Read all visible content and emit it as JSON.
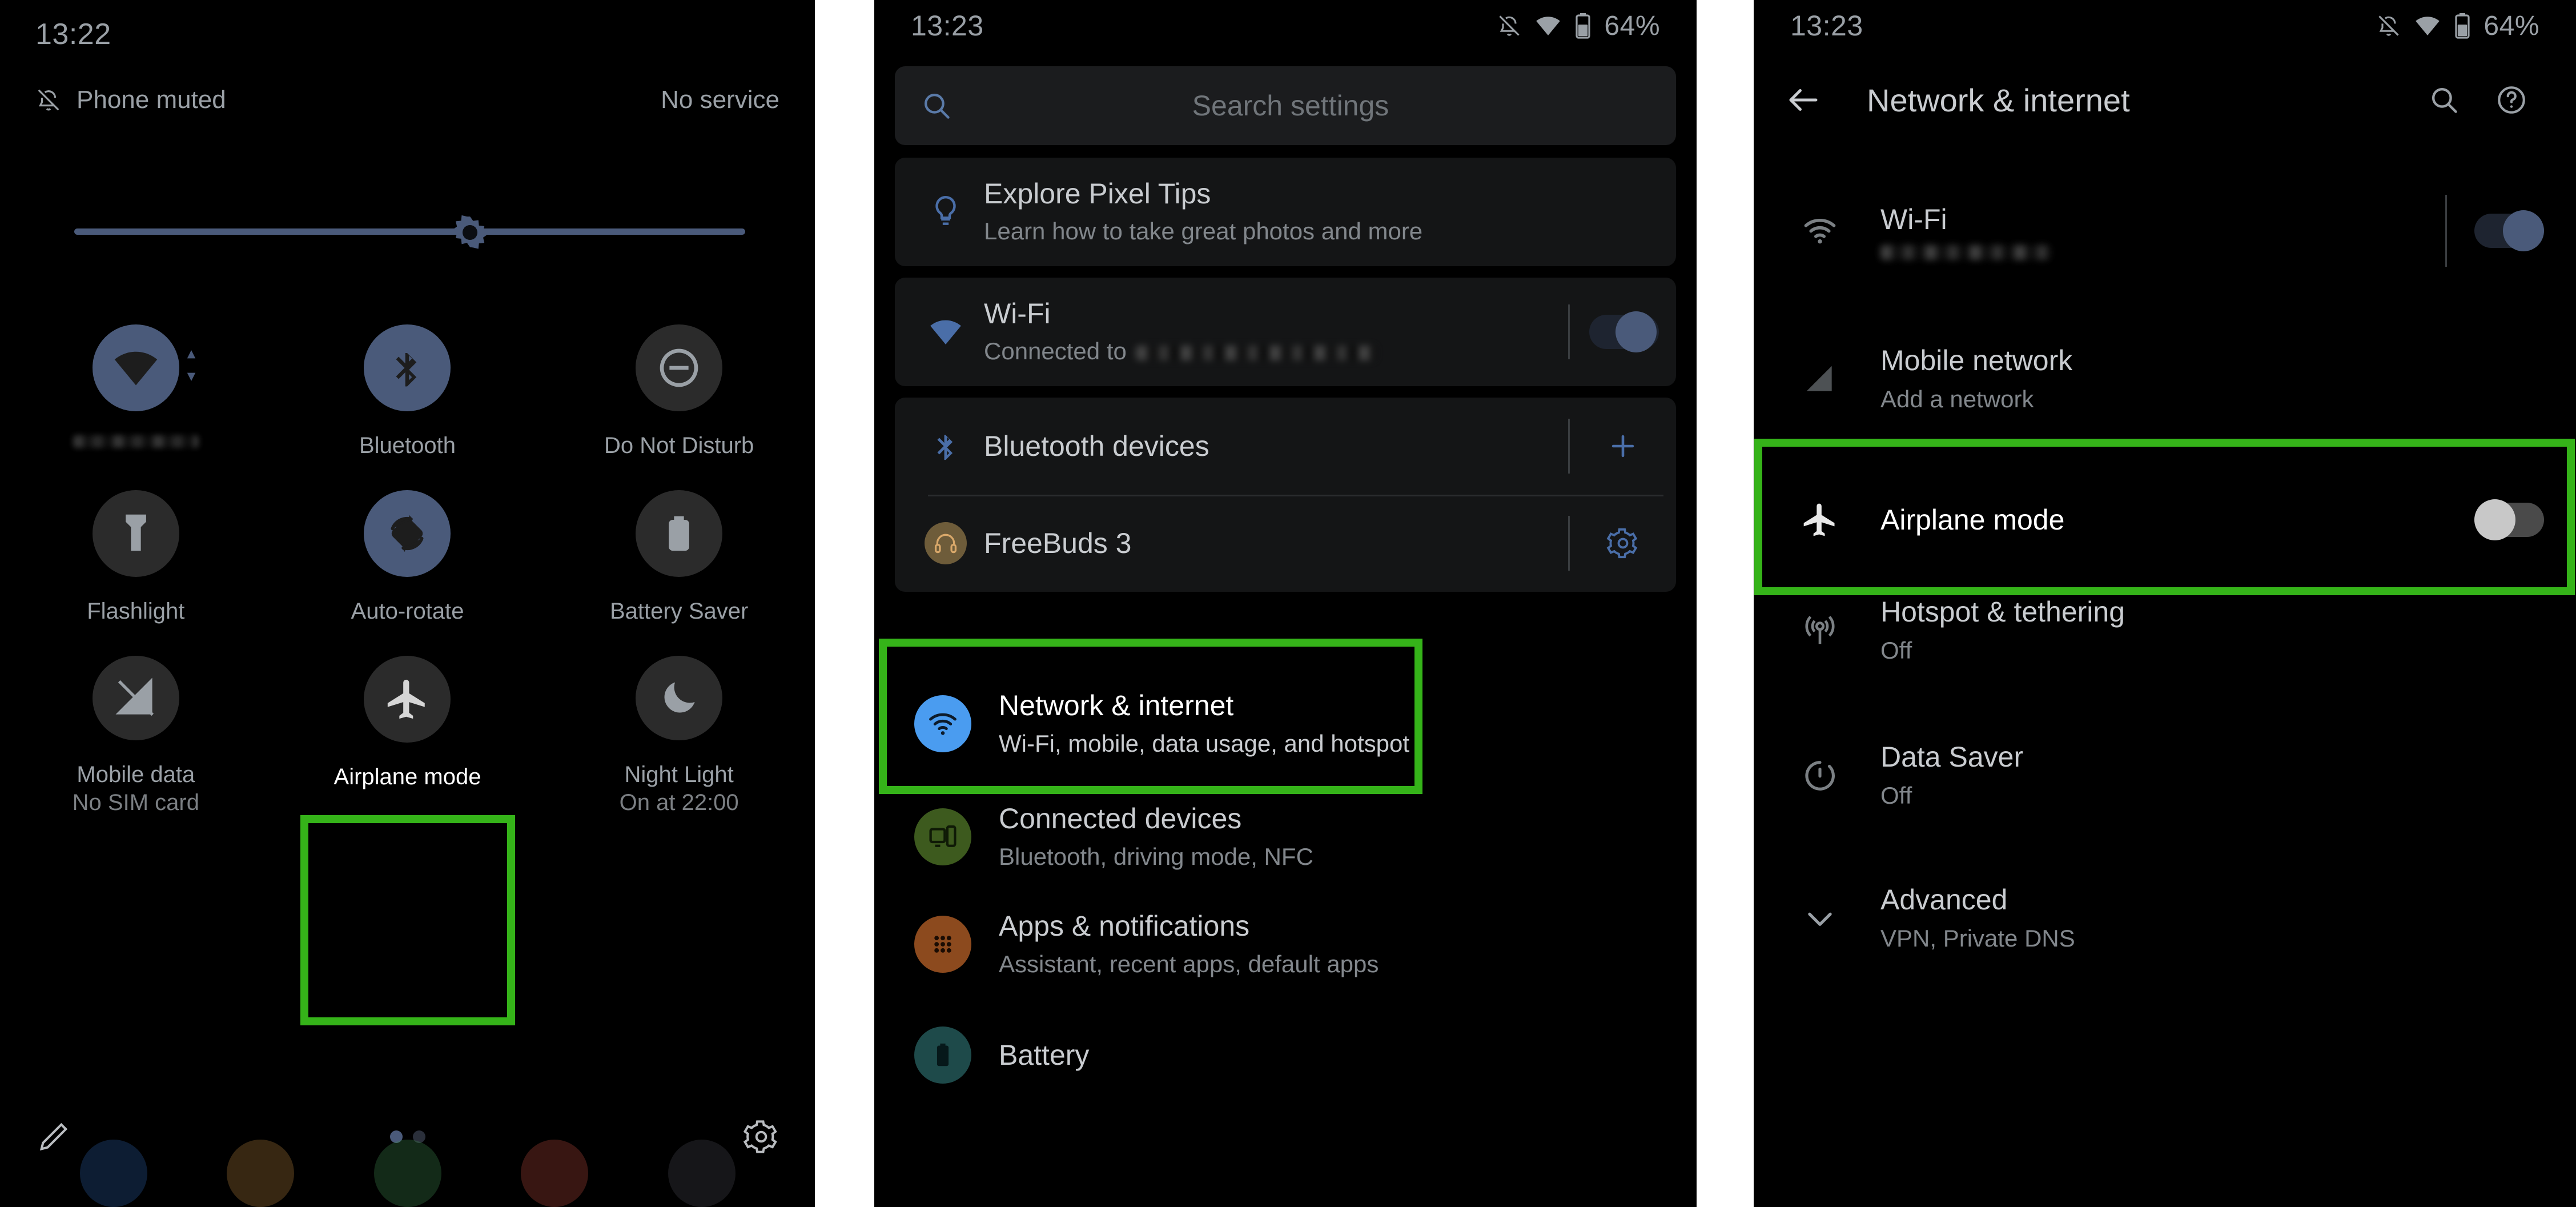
{
  "colors": {
    "highlight_green": "#35b319",
    "tile_active": "#4a5a7a",
    "tile_inactive": "#2b2b2b",
    "network_icon_blue": "#4a9cf0",
    "connected_icon_green": "#3d5a1e",
    "apps_icon_orange": "#8c4a1e",
    "battery_icon_teal": "#1e4a4a",
    "freebuds_icon_tan": "#8c7a52",
    "text_primary": "#c9ccd0",
    "text_secondary": "#82878c"
  },
  "quick_settings": {
    "clock": "13:22",
    "ringer_status": "Phone muted",
    "ringer_icon": "bell-off-icon",
    "service_status": "No service",
    "brightness_percent": 59,
    "tiles": [
      {
        "label": "",
        "sub": "",
        "icon": "wifi-icon",
        "state": "on",
        "redacted_label": true,
        "has_caret": true
      },
      {
        "label": "Bluetooth",
        "sub": "",
        "icon": "bluetooth-icon",
        "state": "on",
        "redacted_label": false,
        "has_caret": false
      },
      {
        "label": "Do Not Disturb",
        "sub": "",
        "icon": "do-not-disturb-icon",
        "state": "off",
        "redacted_label": false,
        "has_caret": false
      },
      {
        "label": "Flashlight",
        "sub": "",
        "icon": "flashlight-icon",
        "state": "off",
        "redacted_label": false,
        "has_caret": false
      },
      {
        "label": "Auto-rotate",
        "sub": "",
        "icon": "auto-rotate-icon",
        "state": "on",
        "redacted_label": false,
        "has_caret": false
      },
      {
        "label": "Battery Saver",
        "sub": "",
        "icon": "battery-saver-icon",
        "state": "off",
        "redacted_label": false,
        "has_caret": false
      },
      {
        "label": "Mobile data",
        "sub": "No SIM card",
        "icon": "mobile-data-off-icon",
        "state": "off",
        "redacted_label": false,
        "has_caret": false
      },
      {
        "label": "Airplane mode",
        "sub": "",
        "icon": "airplane-icon",
        "state": "off",
        "redacted_label": false,
        "has_caret": false,
        "highlighted": true
      },
      {
        "label": "Night Light",
        "sub": "On at 22:00",
        "icon": "night-light-icon",
        "state": "off",
        "redacted_label": false,
        "has_caret": false
      }
    ],
    "footer": {
      "edit_icon": "pencil-icon",
      "settings_icon": "gear-icon",
      "page_current": 1,
      "page_total": 2
    }
  },
  "settings_list": {
    "status": {
      "clock": "13:23",
      "ringer_icon": "bell-off-icon",
      "wifi_icon": "wifi-icon",
      "battery_icon": "battery-icon",
      "battery_percent": "64%"
    },
    "search": {
      "placeholder": "Search settings",
      "icon": "search-icon"
    },
    "tips_card": {
      "icon": "lightbulb-icon",
      "title": "Explore Pixel Tips",
      "subtitle": "Learn how to take great photos and more"
    },
    "wifi_card": {
      "icon": "wifi-icon",
      "title": "Wi-Fi",
      "subtitle_prefix": "Connected to",
      "subtitle_redacted": true,
      "toggle_state": "on"
    },
    "bluetooth_card": {
      "icon": "bluetooth-icon",
      "title": "Bluetooth devices",
      "add_icon": "plus-icon",
      "device_name": "FreeBuds 3",
      "device_icon": "headphones-icon",
      "device_settings_icon": "gear-icon"
    },
    "items": [
      {
        "title": "Network & internet",
        "subtitle": "Wi-Fi, mobile, data usage, and hotspot",
        "icon": "wifi-icon",
        "highlighted": true
      },
      {
        "title": "Connected devices",
        "subtitle": "Bluetooth, driving mode, NFC",
        "icon": "devices-icon",
        "highlighted": false
      },
      {
        "title": "Apps & notifications",
        "subtitle": "Assistant, recent apps, default apps",
        "icon": "apps-grid-icon",
        "highlighted": false
      },
      {
        "title": "Battery",
        "subtitle": "",
        "icon": "battery-icon",
        "highlighted": false
      }
    ]
  },
  "network_screen": {
    "status": {
      "clock": "13:23",
      "ringer_icon": "bell-off-icon",
      "wifi_icon": "wifi-icon",
      "battery_icon": "battery-icon",
      "battery_percent": "64%"
    },
    "appbar": {
      "back_icon": "back-arrow-icon",
      "title": "Network & internet",
      "search_icon": "search-icon",
      "help_icon": "help-circle-icon"
    },
    "rows": [
      {
        "title": "Wi-Fi",
        "subtitle": "",
        "subtitle_redacted": true,
        "icon": "wifi-icon",
        "control": "toggle",
        "toggle_state": "on",
        "highlighted": false
      },
      {
        "title": "Mobile network",
        "subtitle": "Add a network",
        "subtitle_redacted": false,
        "icon": "signal-bars-icon",
        "control": "none",
        "toggle_state": "",
        "highlighted": false
      },
      {
        "title": "Airplane mode",
        "subtitle": "",
        "subtitle_redacted": false,
        "icon": "airplane-icon",
        "control": "toggle",
        "toggle_state": "off",
        "highlighted": true
      },
      {
        "title": "Hotspot & tethering",
        "subtitle": "Off",
        "subtitle_redacted": false,
        "icon": "hotspot-icon",
        "control": "none",
        "toggle_state": "",
        "highlighted": false
      },
      {
        "title": "Data Saver",
        "subtitle": "Off",
        "subtitle_redacted": false,
        "icon": "data-saver-icon",
        "control": "none",
        "toggle_state": "",
        "highlighted": false
      },
      {
        "title": "Advanced",
        "subtitle": "VPN, Private DNS",
        "subtitle_redacted": false,
        "icon": "chevron-down-icon",
        "control": "none",
        "toggle_state": "",
        "highlighted": false
      }
    ]
  }
}
